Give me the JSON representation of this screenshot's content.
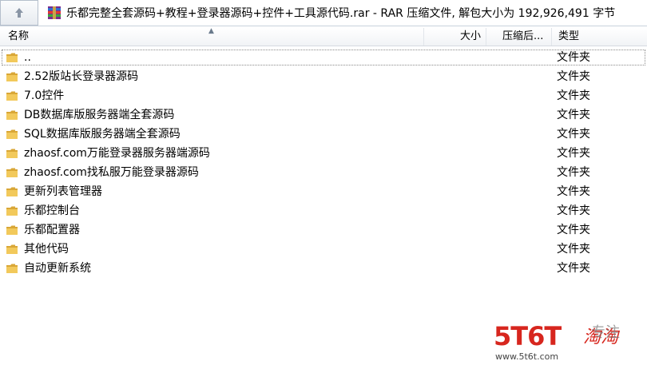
{
  "pathbar": {
    "up_icon": "up-arrow-icon",
    "archive_icon": "rar-archive-icon",
    "path": "乐都完整全套源码+教程+登录器源码+控件+工具源代码.rar - RAR 压缩文件, 解包大小为 192,926,491 字节"
  },
  "columns": {
    "name": "名称",
    "size": "大小",
    "packed": "压缩后...",
    "type": "类型"
  },
  "rows": [
    {
      "name": "..",
      "type": "文件夹"
    },
    {
      "name": "2.52版站长登录器源码",
      "type": "文件夹"
    },
    {
      "name": "7.0控件",
      "type": "文件夹"
    },
    {
      "name": "DB数据库版服务器端全套源码",
      "type": "文件夹"
    },
    {
      "name": "SQL数据库版服务器端全套源码",
      "type": "文件夹"
    },
    {
      "name": "zhaosf.com万能登录器服务器端源码",
      "type": "文件夹"
    },
    {
      "name": "zhaosf.com找私服万能登录器源码",
      "type": "文件夹"
    },
    {
      "name": "更新列表管理器",
      "type": "文件夹"
    },
    {
      "name": "乐都控制台",
      "type": "文件夹"
    },
    {
      "name": "乐都配置器",
      "type": "文件夹"
    },
    {
      "name": "其他代码",
      "type": "文件夹"
    },
    {
      "name": "自动更新系统",
      "type": "文件夹"
    }
  ],
  "watermark": {
    "main": "5T6T",
    "cn": "淘淘",
    "side": "专注",
    "url": "www.5t6t.com"
  },
  "colors": {
    "folder": "#e8b84a",
    "watermark": "#d7261e"
  }
}
